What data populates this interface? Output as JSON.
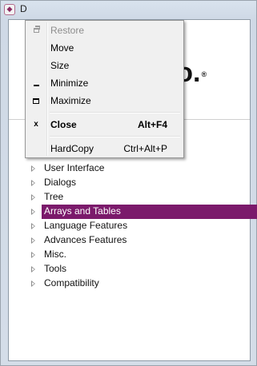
{
  "window": {
    "title": "D",
    "icon": "app-icon"
  },
  "banner": {
    "logo_text": "ro.",
    "logo_mark": "®"
  },
  "tree": {
    "items": [
      {
        "label": "User Interface",
        "selected": false
      },
      {
        "label": "Dialogs",
        "selected": false
      },
      {
        "label": "Tree",
        "selected": false
      },
      {
        "label": "Arrays and Tables",
        "selected": true
      },
      {
        "label": "Language Features",
        "selected": false
      },
      {
        "label": "Advances Features",
        "selected": false
      },
      {
        "label": "Misc.",
        "selected": false
      },
      {
        "label": "Tools",
        "selected": false
      },
      {
        "label": "Compatibility",
        "selected": false
      }
    ],
    "selected_color": "#7b1a6b"
  },
  "system_menu": {
    "items": [
      {
        "label": "Restore",
        "icon": "restore-icon",
        "enabled": false
      },
      {
        "label": "Move",
        "icon": "",
        "enabled": true
      },
      {
        "label": "Size",
        "icon": "",
        "enabled": true
      },
      {
        "label": "Minimize",
        "icon": "minimize-icon",
        "enabled": true
      },
      {
        "label": "Maximize",
        "icon": "maximize-icon",
        "enabled": true
      },
      {
        "label": "Close",
        "icon": "close-icon",
        "icon_glyph": "x",
        "shortcut": "Alt+F4",
        "bold": true,
        "enabled": true
      },
      {
        "label": "HardCopy",
        "icon": "",
        "shortcut": "Ctrl+Alt+P",
        "enabled": true
      }
    ]
  }
}
